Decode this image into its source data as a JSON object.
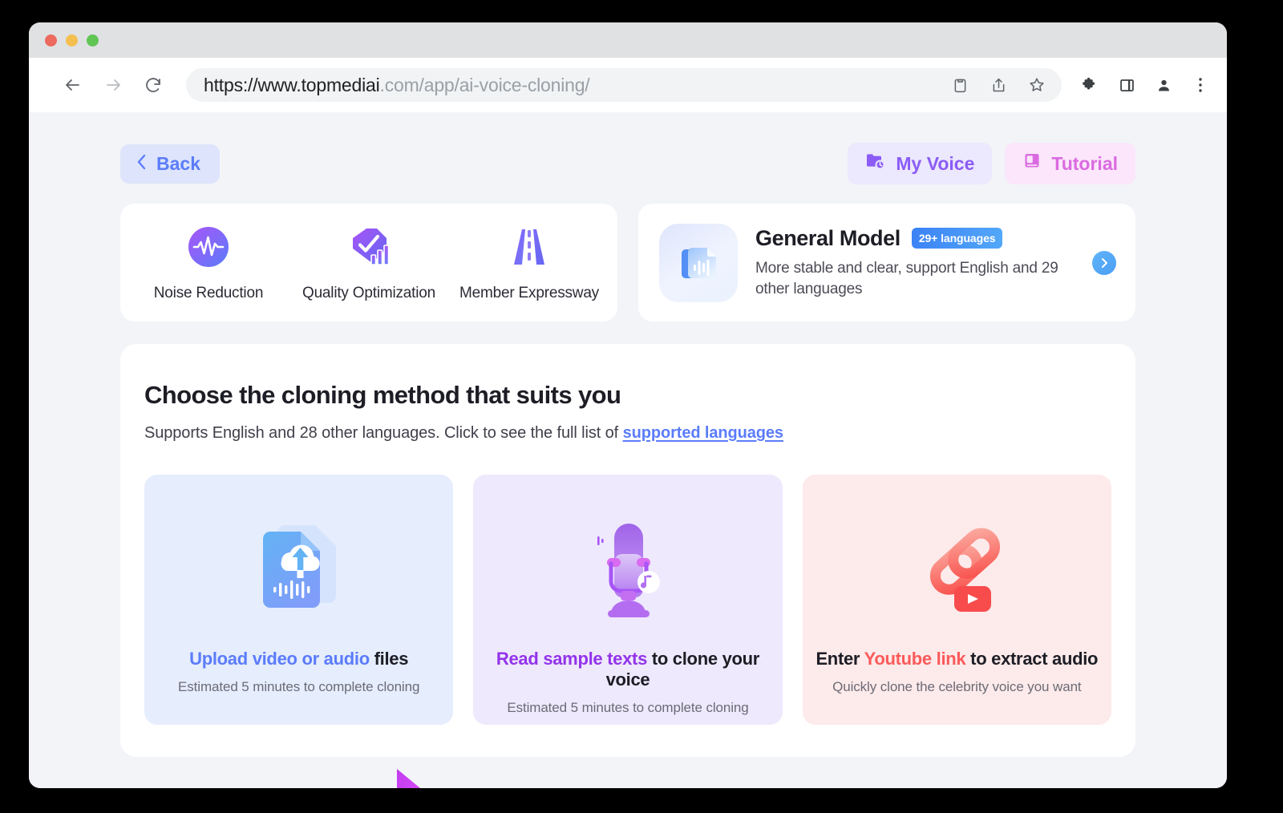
{
  "browser": {
    "url_bold": "https://www.topmediai",
    "url_rest": ".com/app/ai-voice-cloning/",
    "nav": {
      "back": "back-arrow-icon",
      "forward": "forward-arrow-icon",
      "reload": "reload-icon"
    },
    "toolbar_icons": [
      "clipboard-icon",
      "share-icon",
      "bookmark-star-icon",
      "extensions-puzzle-icon",
      "side-panel-icon",
      "profile-avatar-icon",
      "more-menu-icon"
    ]
  },
  "header": {
    "back_label": "Back",
    "my_voice_label": "My Voice",
    "tutorial_label": "Tutorial"
  },
  "features": [
    {
      "label": "Noise Reduction",
      "icon": "waveform-circle-icon"
    },
    {
      "label": "Quality Optimization",
      "icon": "quality-check-gem-icon"
    },
    {
      "label": "Member Expressway",
      "icon": "road-expressway-icon"
    }
  ],
  "model": {
    "title": "General Model",
    "badge": "29+ languages",
    "description": "More stable and clear, support English and 29 other languages",
    "icon": "audio-document-icon",
    "arrow": "chevron-right-icon"
  },
  "main": {
    "title": "Choose the cloning method that suits you",
    "subtitle_before": "Supports English and 28 other languages. Click to see the full list of ",
    "subtitle_link": "supported languages"
  },
  "methods": [
    {
      "id": "upload",
      "icon": "cloud-upload-document-icon",
      "title_accent": "Upload video or audio",
      "title_rest": " files",
      "description": "Estimated 5 minutes to complete cloning"
    },
    {
      "id": "read",
      "icon": "microphone-icon",
      "title_accent": "Read sample texts",
      "title_rest": " to clone your voice",
      "description": "Estimated 5 minutes to complete cloning"
    },
    {
      "id": "youtube",
      "title_pre": "Enter ",
      "icon": "youtube-link-icon",
      "title_accent": "Youtube link",
      "title_rest": " to extract audio",
      "description": "Quickly clone the celebrity voice you want"
    }
  ],
  "colors": {
    "accent_blue": "#5b7cfa",
    "accent_purple": "#9333ea",
    "accent_red": "#fb5a5a",
    "badge_blue": "#3b82f6",
    "cursor": "#cc3df0"
  }
}
